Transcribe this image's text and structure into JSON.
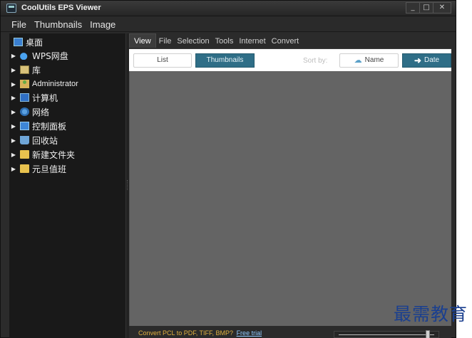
{
  "window": {
    "title": "CoolUtils EPS Viewer",
    "controls": {
      "minimize": "_",
      "maximize": "□",
      "close": "✕"
    }
  },
  "menubar": {
    "items": [
      "File",
      "Thumbnails",
      "Image"
    ]
  },
  "tree": {
    "root": {
      "label": "桌面",
      "icon": "desktop-icon"
    },
    "items": [
      {
        "label": "WPS网盘",
        "icon": "cloud-icon"
      },
      {
        "label": "库",
        "icon": "library-icon"
      },
      {
        "label": "Administrator",
        "icon": "user-folder-icon"
      },
      {
        "label": "计算机",
        "icon": "computer-icon"
      },
      {
        "label": "网络",
        "icon": "network-icon"
      },
      {
        "label": "控制面板",
        "icon": "control-panel-icon"
      },
      {
        "label": "回收站",
        "icon": "recycle-bin-icon"
      },
      {
        "label": "新建文件夹",
        "icon": "folder-icon"
      },
      {
        "label": "元旦值班",
        "icon": "folder-icon"
      }
    ]
  },
  "tabs": {
    "items": [
      "View",
      "File",
      "Selection",
      "Tools",
      "Internet",
      "Convert"
    ],
    "active": "View"
  },
  "toolbar": {
    "list_label": "List",
    "thumbnails_label": "Thumbnails",
    "sort_by_label": "Sort by:",
    "sort_name_label": "Name",
    "sort_date_label": "Date",
    "active_view": "Thumbnails",
    "active_sort": "Date"
  },
  "status": {
    "promo_text": "Convert PCL to PDF, TIFF, BMP?",
    "trial_link": "Free trial",
    "zoom_fraction": 0.93
  },
  "watermark": {
    "text": "最需教育"
  },
  "colors": {
    "accent": "#2f6e87",
    "promo": "#e0b040",
    "link": "#8fc8ff",
    "viewer_bg": "#646464",
    "watermark": "#1a3f8f"
  }
}
